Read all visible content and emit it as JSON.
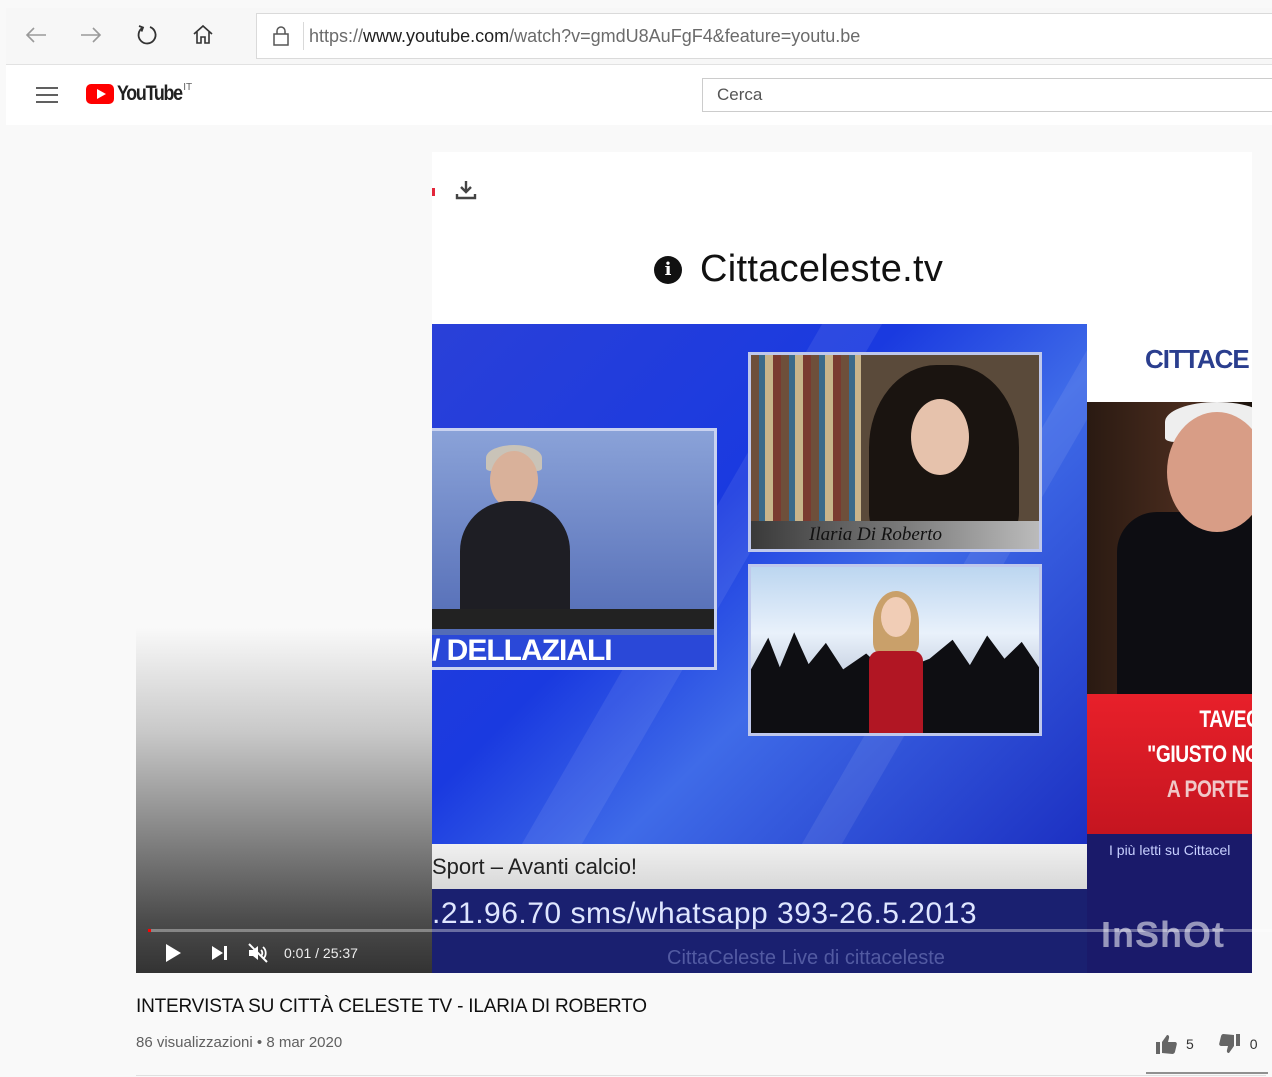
{
  "browser": {
    "url_prefix": "https://",
    "url_host": "www.youtube.com",
    "url_path": "/watch?v=gmdU8AuFgF4&feature=youtu.be"
  },
  "header": {
    "logo_text": "YouTube",
    "country": "IT",
    "search_placeholder": "Cerca"
  },
  "video_content": {
    "channel_title": "Cittaceleste.tv",
    "host_caption": "/ DELLAZIALI",
    "guest1_caption": "Ilaria Di Roberto",
    "side_logo": "CITTACE",
    "side_red_line1": "TAVEC",
    "side_red_line2": "\"GIUSTO NO",
    "side_red_line3": "A PORTE (",
    "side_reads": "I più letti su Cittacel",
    "side_watermark": "InShOt",
    "ticker_line1": "Sport – Avanti calcio!",
    "ticker_line2": ".21.96.70  sms/whatsapp 393-26.5.2013",
    "ticker_line3": "CittaCeleste Live di cittaceleste"
  },
  "player": {
    "time": "0:01 / 25:37",
    "progress": 0.001
  },
  "video": {
    "title": "INTERVISTA SU CITTÀ CELESTE TV - ILARIA DI ROBERTO",
    "views": "86 visualizzazioni",
    "separator": " • ",
    "date": "8 mar 2020",
    "likes": "5",
    "dislikes": "0"
  },
  "colors": {
    "brand_red": "#ff0000",
    "tv_blue": "#1f3fd0"
  }
}
